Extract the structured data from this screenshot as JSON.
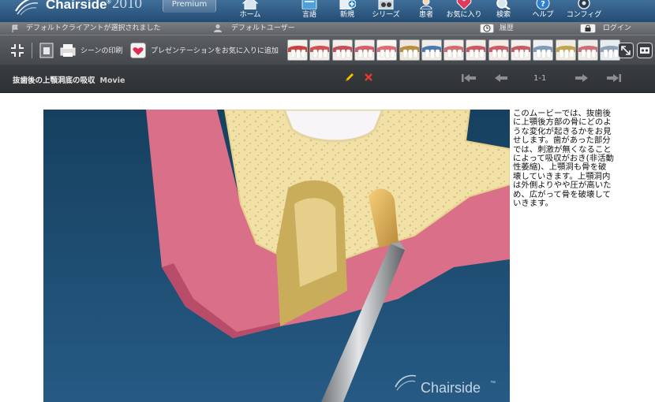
{
  "app": {
    "logo_text": "Chairside",
    "logo_mark": "®",
    "logo_year": "2010",
    "edition": "Premium"
  },
  "nav": {
    "items": [
      {
        "label": "ホーム",
        "icon": "home-icon"
      },
      {
        "label": "言語",
        "icon": "language-book-icon"
      },
      {
        "label": "新規",
        "icon": "new-document-icon"
      },
      {
        "label": "シリーズ",
        "icon": "film-reel-icon"
      },
      {
        "label": "患者",
        "icon": "patient-icon"
      },
      {
        "label": "お気に入り",
        "icon": "favorites-heart-icon"
      },
      {
        "label": "検索",
        "icon": "search-icon"
      },
      {
        "label": "ヘルプ",
        "icon": "help-icon"
      },
      {
        "label": "コンフィグ",
        "icon": "gear-icon"
      }
    ]
  },
  "status": {
    "client": "デフォルトクライアントが選択されました",
    "user": "デフォルトユーザー",
    "history": "履歴",
    "login": "ログイン"
  },
  "toolbar": {
    "print_scene": "シーンの印刷",
    "add_favorite": "プレゼンテーションをお気に入りに追加",
    "thumb_count": 15
  },
  "movie": {
    "title": "抜歯後の上顎洞底の吸収",
    "kind": "Movie",
    "page": "1-1"
  },
  "video": {
    "watermark": "Chairside",
    "watermark_tm": "™"
  },
  "description": "このムービーでは、抜歯後に上顎後方部の骨にどのような変化が起きるかをお見せします。歯があった部分では、刺激が無くなることによって吸収がおき(非活動性萎縮)、上顎洞も骨を破壊していきます。上顎洞内は外側よりやや圧が高いため、広がって骨を破壊していきます。",
  "colors": {
    "header_blue": "#2f5b85",
    "toolbar_gray": "#505357",
    "title_dark": "#333639",
    "video_blue": "#1f4a6f",
    "bone_yellow": "#f1e1a6",
    "gum_pink": "#d96f88",
    "edit_pencil": "#f2c200",
    "delete_x": "#e23b2e"
  }
}
